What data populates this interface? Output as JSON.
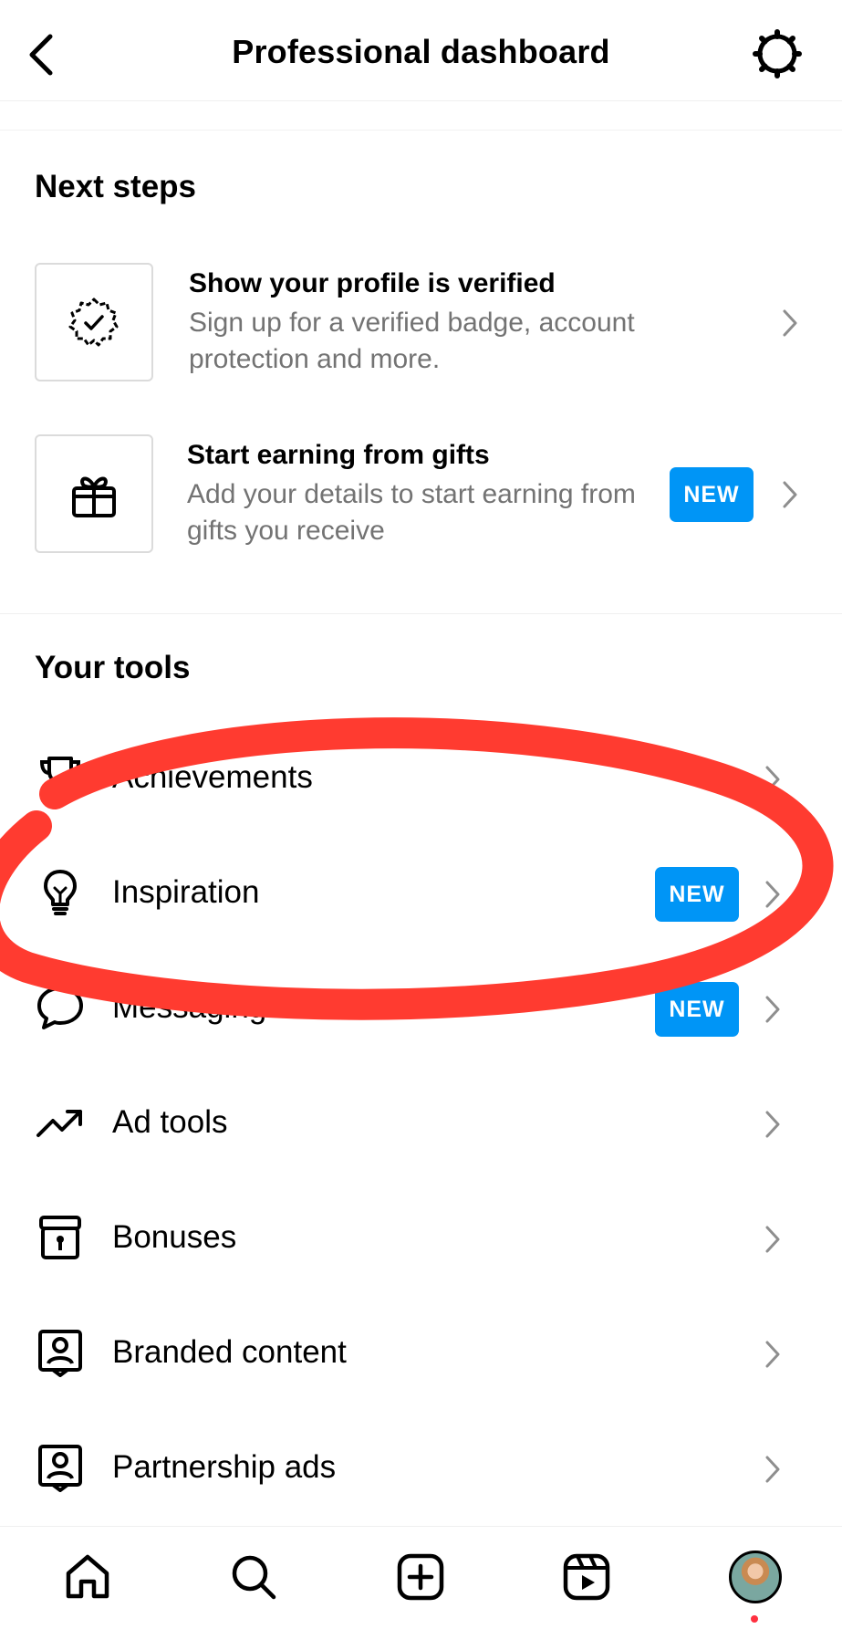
{
  "header": {
    "title": "Professional dashboard"
  },
  "next_steps": {
    "title": "Next steps",
    "items": [
      {
        "title": "Show your profile is verified",
        "description": "Sign up for a verified badge, account protection and more.",
        "badge": ""
      },
      {
        "title": "Start earning from gifts",
        "description": "Add your details to start earning from gifts you receive",
        "badge": "NEW"
      }
    ]
  },
  "tools": {
    "title": "Your tools",
    "items": [
      {
        "label": "Achievements",
        "badge": "",
        "icon": "trophy-icon"
      },
      {
        "label": "Inspiration",
        "badge": "NEW",
        "icon": "lightbulb-icon"
      },
      {
        "label": "Messaging tools",
        "badge": "NEW",
        "icon": "chat-bubble-icon"
      },
      {
        "label": "Ad tools",
        "badge": "",
        "icon": "trending-up-icon"
      },
      {
        "label": "Bonuses",
        "badge": "",
        "icon": "gift-box-icon"
      },
      {
        "label": "Branded content",
        "badge": "",
        "icon": "branded-content-icon"
      },
      {
        "label": "Partnership ads",
        "badge": "",
        "icon": "partnership-icon"
      }
    ]
  },
  "tabbar": {
    "items": [
      "home-icon",
      "search-icon",
      "create-icon",
      "reels-icon",
      "profile-avatar"
    ]
  },
  "colors": {
    "accent_blue": "#0095f6",
    "annotation_red": "#ff3b30",
    "secondary_text": "#737373"
  }
}
